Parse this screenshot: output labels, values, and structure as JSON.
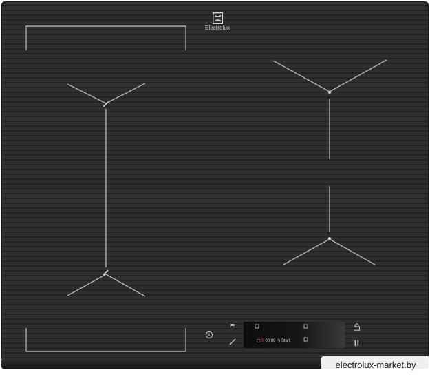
{
  "brand": {
    "name": "Electrolux",
    "icon": "electrolux-logo-icon"
  },
  "display": {
    "timer": "00:00",
    "start_label": "Start",
    "power_level": "0"
  },
  "controls": {
    "menu_icon": "menu-icon",
    "power_icon": "power-icon",
    "edit_icon": "pencil-icon",
    "lock_icon": "lock-icon",
    "pause_icon": "pause-icon"
  },
  "watermark": "electrolux-market.by",
  "colors": {
    "surface": "#2e2e2e",
    "zone_lines": "#b3b3b3",
    "display_accent": "#e85050"
  }
}
